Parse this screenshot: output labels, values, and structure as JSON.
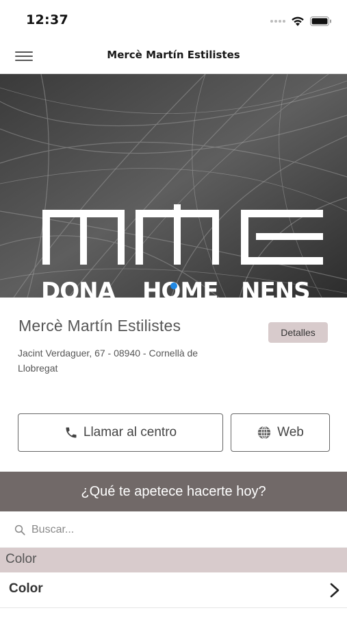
{
  "status_bar": {
    "time": "12:37"
  },
  "nav": {
    "title": "Mercè Martín Estilistes"
  },
  "banner": {
    "logo_text": "MME",
    "subtitles": [
      "DONA",
      "HOME",
      "NENS"
    ],
    "page_indicator": {
      "active": 1,
      "total": 1,
      "color": "#1e88e5"
    }
  },
  "salon": {
    "name": "Mercè Martín Estilistes",
    "details_label": "Detalles",
    "address": "Jacint Verdaguer, 67 - 08940 - Cornellà de Llobregat"
  },
  "actions": {
    "call_label": "Llamar al centro",
    "web_label": "Web"
  },
  "question": {
    "text": "¿Qué te apetece hacerte hoy?"
  },
  "search": {
    "placeholder": "Buscar...",
    "value": ""
  },
  "services": {
    "section_title": "Color",
    "items": [
      {
        "label": "Color"
      }
    ]
  },
  "colors": {
    "accent": "#d8cbcc",
    "question_bar": "#716968"
  },
  "icons": [
    "wifi-icon",
    "battery-icon",
    "signal-icon",
    "hamburger-menu-icon",
    "phone-icon",
    "globe-icon",
    "search-icon",
    "chevron-right-icon"
  ]
}
